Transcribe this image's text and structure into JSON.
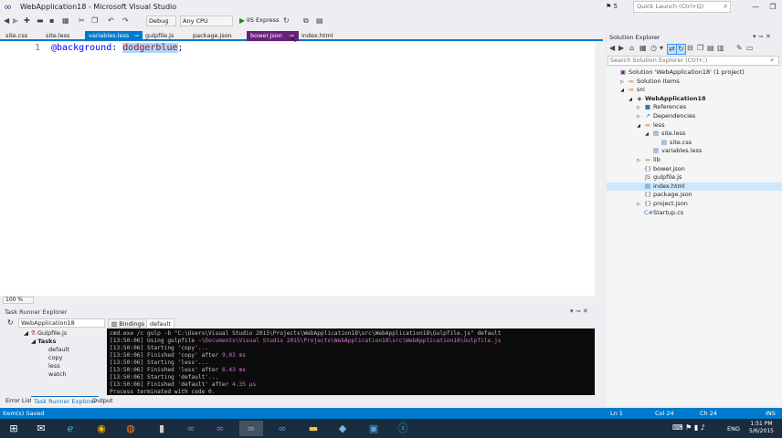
{
  "window": {
    "title": "WebApplication18 - Microsoft Visual Studio",
    "notifications": "5",
    "quick_launch_placeholder": "Quick Launch (Ctrl+Q)"
  },
  "toolbar": {
    "config": "Debug",
    "platform": "Any CPU",
    "run_target": "IIS Express"
  },
  "doc_tabs": [
    {
      "label": "site.css"
    },
    {
      "label": "site.less"
    },
    {
      "label": "variables.less"
    },
    {
      "label": "gulpfile.js"
    },
    {
      "label": "package.json"
    },
    {
      "label": "bower.json"
    },
    {
      "label": "index.html"
    }
  ],
  "editor": {
    "line_number": "1",
    "code_property": "@background:",
    "code_value": "dodgerblue",
    "code_end": ";",
    "zoom": "100 %"
  },
  "task_runner": {
    "title": "Task Runner Explorer",
    "project": "WebApplication18",
    "tree": {
      "root": "Gulpfile.js",
      "group": "Tasks",
      "tasks": [
        "default",
        "copy",
        "less",
        "watch"
      ]
    },
    "tabs": {
      "bindings": "Bindings",
      "default": "default"
    },
    "terminal_lines": [
      {
        "text": "cmd.exe /c gulp -b \"C:\\Users\\Visual Studio 2015\\Projects\\WebApplication18\\src\\WebApplication18\\Gulpfile.js\" default",
        "m": ""
      },
      {
        "text": "[13:50:06] Using gulpfile ",
        "m": "~\\Documents\\Visual Studio 2015\\Projects\\WebApplication18\\src\\WebApplication18\\Gulpfile.js"
      },
      {
        "text": "[13:50:06] Starting 'copy'...",
        "m": ""
      },
      {
        "text": "[13:50:06] Finished 'copy' after ",
        "m": "9.03 ms"
      },
      {
        "text": "[13:50:06] Starting 'less'...",
        "m": ""
      },
      {
        "text": "[13:50:06] Finished 'less' after ",
        "m": "6.43 ms"
      },
      {
        "text": "[13:50:06] Starting 'default'...",
        "m": ""
      },
      {
        "text": "[13:50:06] Finished 'default' after ",
        "m": "4.35 μs"
      },
      {
        "text": "Process terminated with code 0.",
        "m": ""
      }
    ]
  },
  "bottom_tabs": [
    "Error List",
    "Task Runner Explorer",
    "Output"
  ],
  "solution_explorer": {
    "title": "Solution Explorer",
    "search_placeholder": "Search Solution Explorer (Ctrl+;)",
    "items": [
      {
        "label": "Solution 'WebApplication18' (1 project)",
        "icon": "solution-icon",
        "glyph": "▣",
        "exp": ""
      },
      {
        "label": "Solution Items",
        "icon": "folder-icon",
        "glyph": "▬",
        "exp": "▷"
      },
      {
        "label": "src",
        "icon": "folder-icon",
        "glyph": "▬",
        "exp": "◢"
      },
      {
        "label": "WebApplication18",
        "icon": "project-icon",
        "glyph": "◈",
        "exp": "◢"
      },
      {
        "label": "References",
        "icon": "references-icon",
        "glyph": "■",
        "exp": "▷"
      },
      {
        "label": "Dependencies",
        "icon": "dependencies-icon",
        "glyph": "↗",
        "exp": "▷"
      },
      {
        "label": "less",
        "icon": "folder-icon",
        "glyph": "▬",
        "exp": "◢"
      },
      {
        "label": "site.less",
        "icon": "file-icon",
        "glyph": "▤",
        "exp": "◢"
      },
      {
        "label": "site.css",
        "icon": "file-icon",
        "glyph": "▤",
        "exp": ""
      },
      {
        "label": "variables.less",
        "icon": "file-icon",
        "glyph": "▤",
        "exp": ""
      },
      {
        "label": "lib",
        "icon": "folder-icon",
        "glyph": "▬",
        "exp": "▷"
      },
      {
        "label": "bower.json",
        "icon": "json-icon",
        "glyph": "{}",
        "exp": ""
      },
      {
        "label": "gulpfile.js",
        "icon": "js-icon",
        "glyph": "JS",
        "exp": ""
      },
      {
        "label": "index.html",
        "icon": "html-icon",
        "glyph": "▤",
        "exp": ""
      },
      {
        "label": "package.json",
        "icon": "json-icon",
        "glyph": "{}",
        "exp": ""
      },
      {
        "label": "project.json",
        "icon": "json-icon",
        "glyph": "{}",
        "exp": "▷"
      },
      {
        "label": "Startup.cs",
        "icon": "cs-icon",
        "glyph": "C#",
        "exp": ""
      }
    ]
  },
  "status_bar": {
    "message": "Item(s) Saved",
    "line": "Ln 1",
    "col": "Col 24",
    "ch": "Ch 24",
    "mode": "INS"
  },
  "taskbar": {
    "lang": "ENG",
    "time": "1:51 PM",
    "date": "5/6/2015"
  },
  "colors": {
    "accent": "#007acc",
    "vs_purple": "#68217a",
    "terminal_magenta": "#d670d6"
  }
}
